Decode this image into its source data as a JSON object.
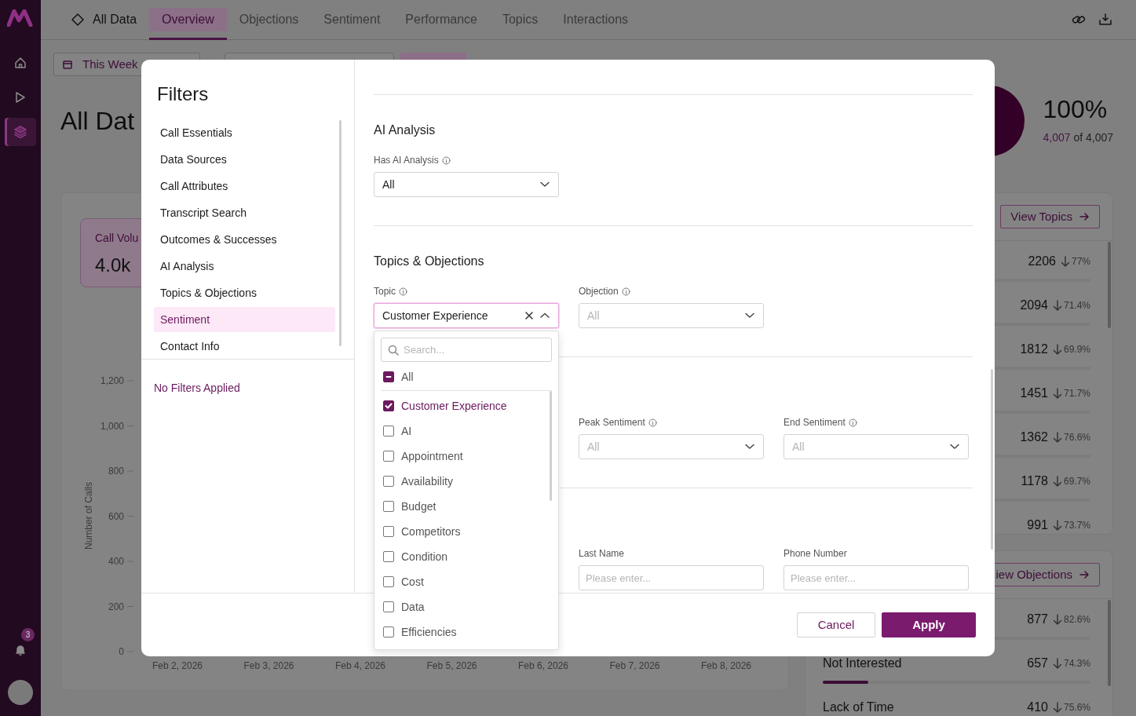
{
  "sidebar": {
    "items": [
      {
        "kind": "home",
        "selected": false
      },
      {
        "kind": "play",
        "selected": false
      },
      {
        "kind": "layers",
        "selected": true
      }
    ],
    "notification_count": "3"
  },
  "top_tabs": [
    {
      "label": "All Data",
      "kind": "root",
      "selected": false
    },
    {
      "label": "Overview",
      "kind": "tab",
      "selected": true
    },
    {
      "label": "Objections",
      "kind": "tab",
      "selected": false
    },
    {
      "label": "Sentiment",
      "kind": "tab",
      "selected": false
    },
    {
      "label": "Performance",
      "kind": "tab",
      "selected": false
    },
    {
      "label": "Topics",
      "kind": "tab",
      "selected": false
    },
    {
      "label": "Interactions",
      "kind": "tab",
      "selected": false
    }
  ],
  "date_button": {
    "label": "This Week"
  },
  "page_title": "All Dat",
  "coverage": {
    "percent": "100%",
    "count": "4,007",
    "of_total": "of 4,007"
  },
  "kpi_card": {
    "label": "Call Volu",
    "value": "4.0k"
  },
  "call_chart": {
    "ylabel": "Number of Calls",
    "yticks": [
      "1,200",
      "1,000",
      "800",
      "600",
      "400",
      "200",
      "0"
    ],
    "xticks": [
      "Feb 2, 2026",
      "Feb 3, 2026",
      "Feb 4, 2026",
      "Feb 5, 2026",
      "Feb 6, 2026",
      "Feb 7, 2026",
      "Feb 8, 2026"
    ]
  },
  "topics_panel": {
    "button": "View Topics",
    "rows": [
      {
        "value": "2206",
        "change": "77%"
      },
      {
        "value": "2094",
        "change": "71.4%"
      },
      {
        "value": "1812",
        "change": "69.9%"
      },
      {
        "value": "1451",
        "change": "71.7%"
      },
      {
        "value": "1362",
        "change": "76.6%"
      },
      {
        "value": "1178",
        "change": "69.7%"
      },
      {
        "value": "991",
        "change": "73.7%"
      }
    ]
  },
  "objections_panel": {
    "button": "iew Objections",
    "rows": [
      {
        "value": "877",
        "change": "82.6%"
      },
      {
        "label": "Not Interested",
        "value": "657",
        "change": "74.3%",
        "level": 0.17
      },
      {
        "label": "Lack of Time",
        "value": "410",
        "change": "75.6%"
      }
    ]
  },
  "filters_dialog": {
    "title": "Filters",
    "nav": [
      {
        "label": "Call Essentials",
        "selected": false
      },
      {
        "label": "Data Sources",
        "selected": false
      },
      {
        "label": "Call Attributes",
        "selected": false
      },
      {
        "label": "Transcript Search",
        "selected": false
      },
      {
        "label": "Outcomes & Successes",
        "selected": false
      },
      {
        "label": "AI Analysis",
        "selected": false
      },
      {
        "label": "Topics & Objections",
        "selected": false
      },
      {
        "label": "Sentiment",
        "selected": true
      },
      {
        "label": "Contact Info",
        "selected": false
      }
    ],
    "status": "No Filters Applied",
    "sections": [
      {
        "title": "AI Analysis",
        "first_column_hidden": false,
        "fields": [
          {
            "label": "Has AI Analysis",
            "info": true,
            "kind": "select",
            "value": "All",
            "expanded": false,
            "clearable": false
          }
        ]
      },
      {
        "title": "Topics & Objections",
        "first_column_hidden": false,
        "fields": [
          {
            "label": "Topic",
            "info": true,
            "kind": "select",
            "value": "Customer Experience",
            "expanded": true,
            "clearable": true
          },
          {
            "label": "Objection",
            "info": true,
            "kind": "select",
            "placeholder": "All",
            "expanded": false,
            "clearable": false
          }
        ]
      },
      {
        "first_column_hidden": true,
        "fields": [
          {
            "label": "Peak Sentiment",
            "info": true,
            "kind": "select",
            "placeholder": "All",
            "expanded": false,
            "clearable": false
          },
          {
            "label": "End Sentiment",
            "info": true,
            "kind": "select",
            "placeholder": "All",
            "expanded": false,
            "clearable": false
          }
        ]
      },
      {
        "first_column_hidden": true,
        "fields": [
          {
            "label": "Last Name",
            "info": false,
            "kind": "input",
            "placeholder": "Please enter..."
          },
          {
            "label": "Phone Number",
            "info": false,
            "kind": "input",
            "placeholder": "Please enter..."
          }
        ]
      }
    ],
    "topic_menu": {
      "search_placeholder": "Search...",
      "all_option": {
        "label": "All",
        "indeterminate": true
      },
      "options": [
        {
          "label": "Customer Experience",
          "checked": true
        },
        {
          "label": "AI",
          "checked": false
        },
        {
          "label": "Appointment",
          "checked": false
        },
        {
          "label": "Availability",
          "checked": false
        },
        {
          "label": "Budget",
          "checked": false
        },
        {
          "label": "Competitors",
          "checked": false
        },
        {
          "label": "Condition",
          "checked": false
        },
        {
          "label": "Cost",
          "checked": false
        },
        {
          "label": "Data",
          "checked": false
        },
        {
          "label": "Efficiencies",
          "checked": false
        }
      ]
    },
    "buttons": [
      {
        "label": "Cancel",
        "kind": "secondary"
      },
      {
        "label": "Apply",
        "kind": "primary"
      }
    ]
  }
}
